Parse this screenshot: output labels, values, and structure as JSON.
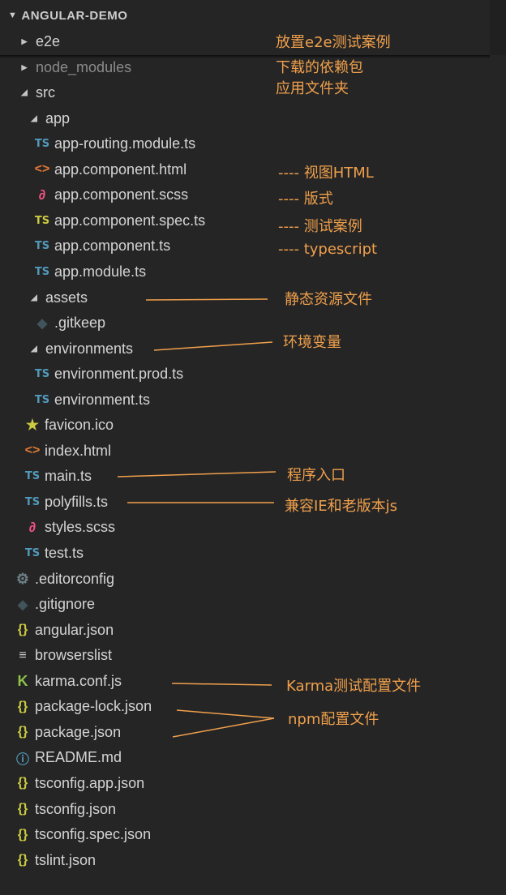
{
  "explorer": {
    "title": "ANGULAR-DEMO"
  },
  "tree": [
    {
      "label": "e2e",
      "type": "folder-closed",
      "icon": "chevron-right-icon",
      "depth": 0
    },
    {
      "label": "node_modules",
      "type": "folder-closed",
      "icon": "chevron-right-icon",
      "depth": 0,
      "dim": true
    },
    {
      "label": "src",
      "type": "folder-open",
      "icon": "chevron-down-icon",
      "depth": 0
    },
    {
      "label": "app",
      "type": "folder-open",
      "icon": "chevron-down-icon",
      "depth": 1
    },
    {
      "label": "app-routing.module.ts",
      "type": "ts",
      "icon": "typescript-icon",
      "badge": "TS",
      "depth": 2
    },
    {
      "label": "app.component.html",
      "type": "html",
      "icon": "html-icon",
      "badge": "<>",
      "depth": 2
    },
    {
      "label": "app.component.scss",
      "type": "scss",
      "icon": "sass-icon",
      "badge": "∂",
      "depth": 2
    },
    {
      "label": "app.component.spec.ts",
      "type": "spec",
      "icon": "typescript-spec-icon",
      "badge": "TS",
      "depth": 2
    },
    {
      "label": "app.component.ts",
      "type": "ts",
      "icon": "typescript-icon",
      "badge": "TS",
      "depth": 2
    },
    {
      "label": "app.module.ts",
      "type": "ts",
      "icon": "typescript-icon",
      "badge": "TS",
      "depth": 2
    },
    {
      "label": "assets",
      "type": "folder-open",
      "icon": "chevron-down-icon",
      "depth": 1
    },
    {
      "label": ".gitkeep",
      "type": "git",
      "icon": "git-icon",
      "badge": "◆",
      "depth": 2
    },
    {
      "label": "environments",
      "type": "folder-open",
      "icon": "chevron-down-icon",
      "depth": 1
    },
    {
      "label": "environment.prod.ts",
      "type": "ts",
      "icon": "typescript-icon",
      "badge": "TS",
      "depth": 2
    },
    {
      "label": "environment.ts",
      "type": "ts",
      "icon": "typescript-icon",
      "badge": "TS",
      "depth": 2
    },
    {
      "label": "favicon.ico",
      "type": "star",
      "icon": "star-icon",
      "badge": "★",
      "depth": 1
    },
    {
      "label": "index.html",
      "type": "html",
      "icon": "html-icon",
      "badge": "<>",
      "depth": 1
    },
    {
      "label": "main.ts",
      "type": "ts",
      "icon": "typescript-icon",
      "badge": "TS",
      "depth": 1
    },
    {
      "label": "polyfills.ts",
      "type": "ts",
      "icon": "typescript-icon",
      "badge": "TS",
      "depth": 1
    },
    {
      "label": "styles.scss",
      "type": "scss",
      "icon": "sass-icon",
      "badge": "∂",
      "depth": 1
    },
    {
      "label": "test.ts",
      "type": "ts",
      "icon": "typescript-icon",
      "badge": "TS",
      "depth": 1
    },
    {
      "label": ".editorconfig",
      "type": "gear",
      "icon": "gear-icon",
      "badge": "⚙",
      "depth": 0
    },
    {
      "label": ".gitignore",
      "type": "git",
      "icon": "git-icon",
      "badge": "◆",
      "depth": 0
    },
    {
      "label": "angular.json",
      "type": "json",
      "icon": "json-icon",
      "badge": "{}",
      "depth": 0
    },
    {
      "label": "browserslist",
      "type": "list",
      "icon": "list-icon",
      "badge": "≡",
      "depth": 0
    },
    {
      "label": "karma.conf.js",
      "type": "karma",
      "icon": "karma-icon",
      "badge": "K",
      "depth": 0
    },
    {
      "label": "package-lock.json",
      "type": "json",
      "icon": "json-icon",
      "badge": "{}",
      "depth": 0
    },
    {
      "label": "package.json",
      "type": "json",
      "icon": "json-icon",
      "badge": "{}",
      "depth": 0
    },
    {
      "label": "README.md",
      "type": "info",
      "icon": "info-icon",
      "badge": "ⓘ",
      "depth": 0
    },
    {
      "label": "tsconfig.app.json",
      "type": "json",
      "icon": "json-icon",
      "badge": "{}",
      "depth": 0
    },
    {
      "label": "tsconfig.json",
      "type": "json",
      "icon": "json-icon",
      "badge": "{}",
      "depth": 0
    },
    {
      "label": "tsconfig.spec.json",
      "type": "json",
      "icon": "json-icon",
      "badge": "{}",
      "depth": 0
    },
    {
      "label": "tslint.json",
      "type": "json",
      "icon": "json-icon",
      "badge": "{}",
      "depth": 0
    }
  ],
  "annotations": {
    "e2e": "放置e2e测试案例",
    "node_modules": "下载的依赖包",
    "src": "应用文件夹",
    "html": "---- 视图HTML",
    "scss": "---- 版式",
    "spec": "---- 测试案例",
    "ts": "---- typescript",
    "assets": "静态资源文件",
    "environments": "环境变量",
    "main": "程序入口",
    "polyfills": "兼容IE和老版本js",
    "karma": "Karma测试配置文件",
    "npm": "npm配置文件"
  },
  "colors": {
    "background": "#252526",
    "annotation": "#f0a04b",
    "ts_icon": "#519aba",
    "json_icon": "#cbcb41"
  }
}
